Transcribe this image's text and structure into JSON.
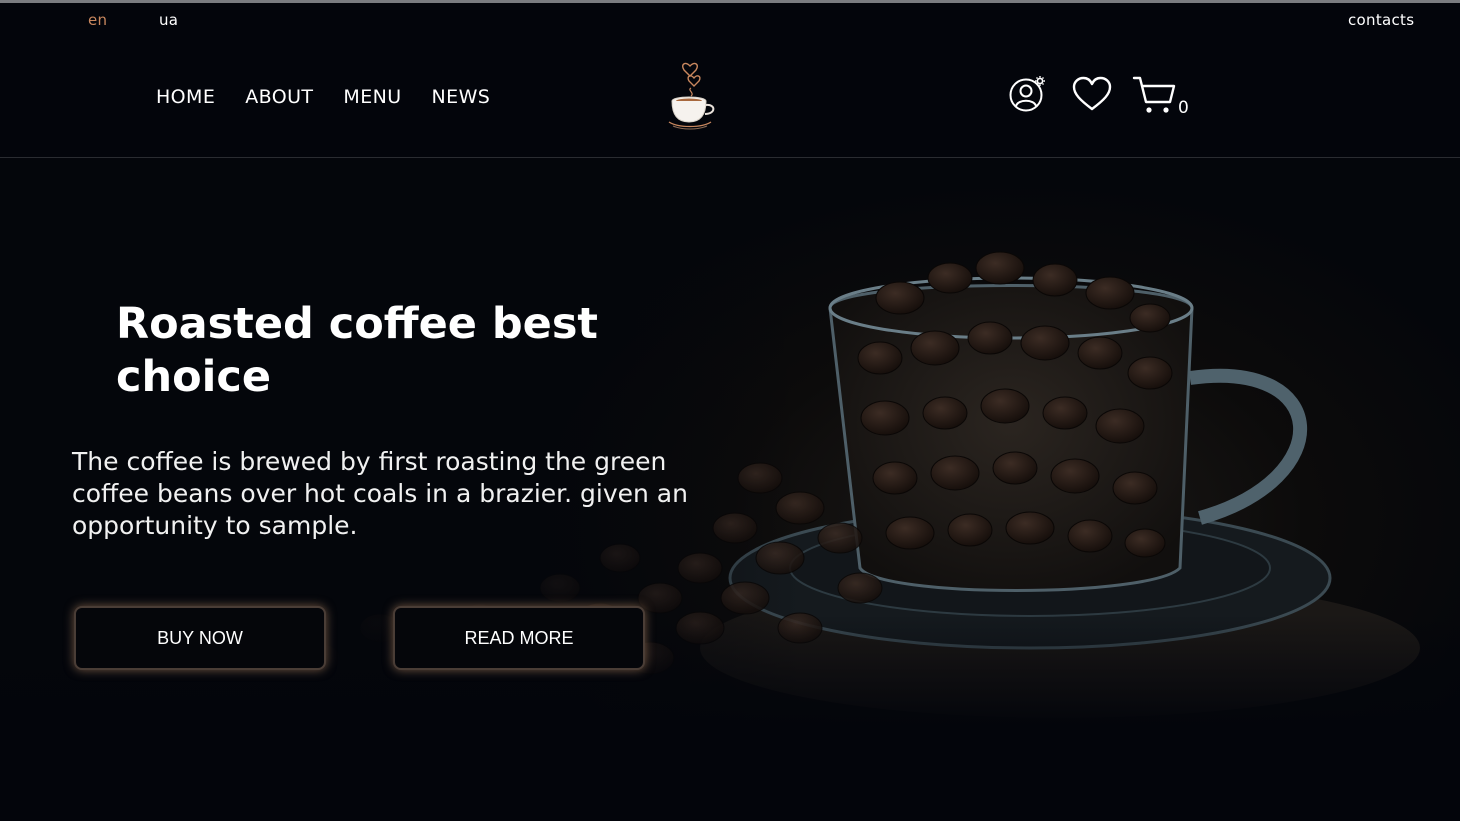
{
  "topbar": {
    "languages": [
      "en",
      "ua"
    ],
    "active_language": "en",
    "contacts_label": "contacts"
  },
  "nav": {
    "items": [
      {
        "label": "HOME"
      },
      {
        "label": "ABOUT"
      },
      {
        "label": "MENU"
      },
      {
        "label": "NEWS"
      }
    ]
  },
  "header_icons": {
    "user": "user-settings-icon",
    "wishlist": "heart-icon",
    "cart": "cart-icon",
    "cart_count": "0"
  },
  "hero": {
    "title": "Roasted coffee best choice",
    "text": "The coffee is brewed by first roasting the green coffee beans over hot coals in a brazier. given an opportunity to sample.",
    "buy_label": "BUY NOW",
    "read_label": "READ MORE"
  },
  "colors": {
    "background": "#03050b",
    "accent": "#c8875e",
    "text": "#ffffff"
  }
}
